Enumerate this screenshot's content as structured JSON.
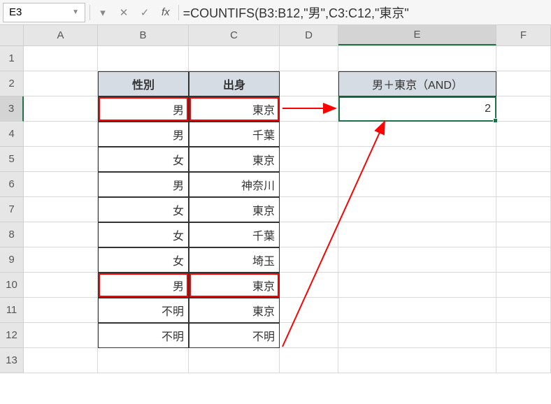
{
  "formula_bar": {
    "name_box": "E3",
    "formula": "=COUNTIFS(B3:B12,\"男\",C3:C12,\"東京\""
  },
  "columns": [
    "A",
    "B",
    "C",
    "D",
    "E",
    "F"
  ],
  "selected_column": "E",
  "selected_row": "3",
  "row_numbers": [
    "1",
    "2",
    "3",
    "4",
    "5",
    "6",
    "7",
    "8",
    "9",
    "10",
    "11",
    "12",
    "13"
  ],
  "headers": {
    "B": "性別",
    "C": "出身",
    "E": "男＋東京（AND）"
  },
  "data_rows": [
    {
      "B": "男",
      "C": "東京",
      "hl": true
    },
    {
      "B": "男",
      "C": "千葉",
      "hl": false
    },
    {
      "B": "女",
      "C": "東京",
      "hl": false
    },
    {
      "B": "男",
      "C": "神奈川",
      "hl": false
    },
    {
      "B": "女",
      "C": "東京",
      "hl": false
    },
    {
      "B": "女",
      "C": "千葉",
      "hl": false
    },
    {
      "B": "女",
      "C": "埼玉",
      "hl": false
    },
    {
      "B": "男",
      "C": "東京",
      "hl": true
    },
    {
      "B": "不明",
      "C": "東京",
      "hl": false
    },
    {
      "B": "不明",
      "C": "不明",
      "hl": false
    }
  ],
  "result_value": "2"
}
